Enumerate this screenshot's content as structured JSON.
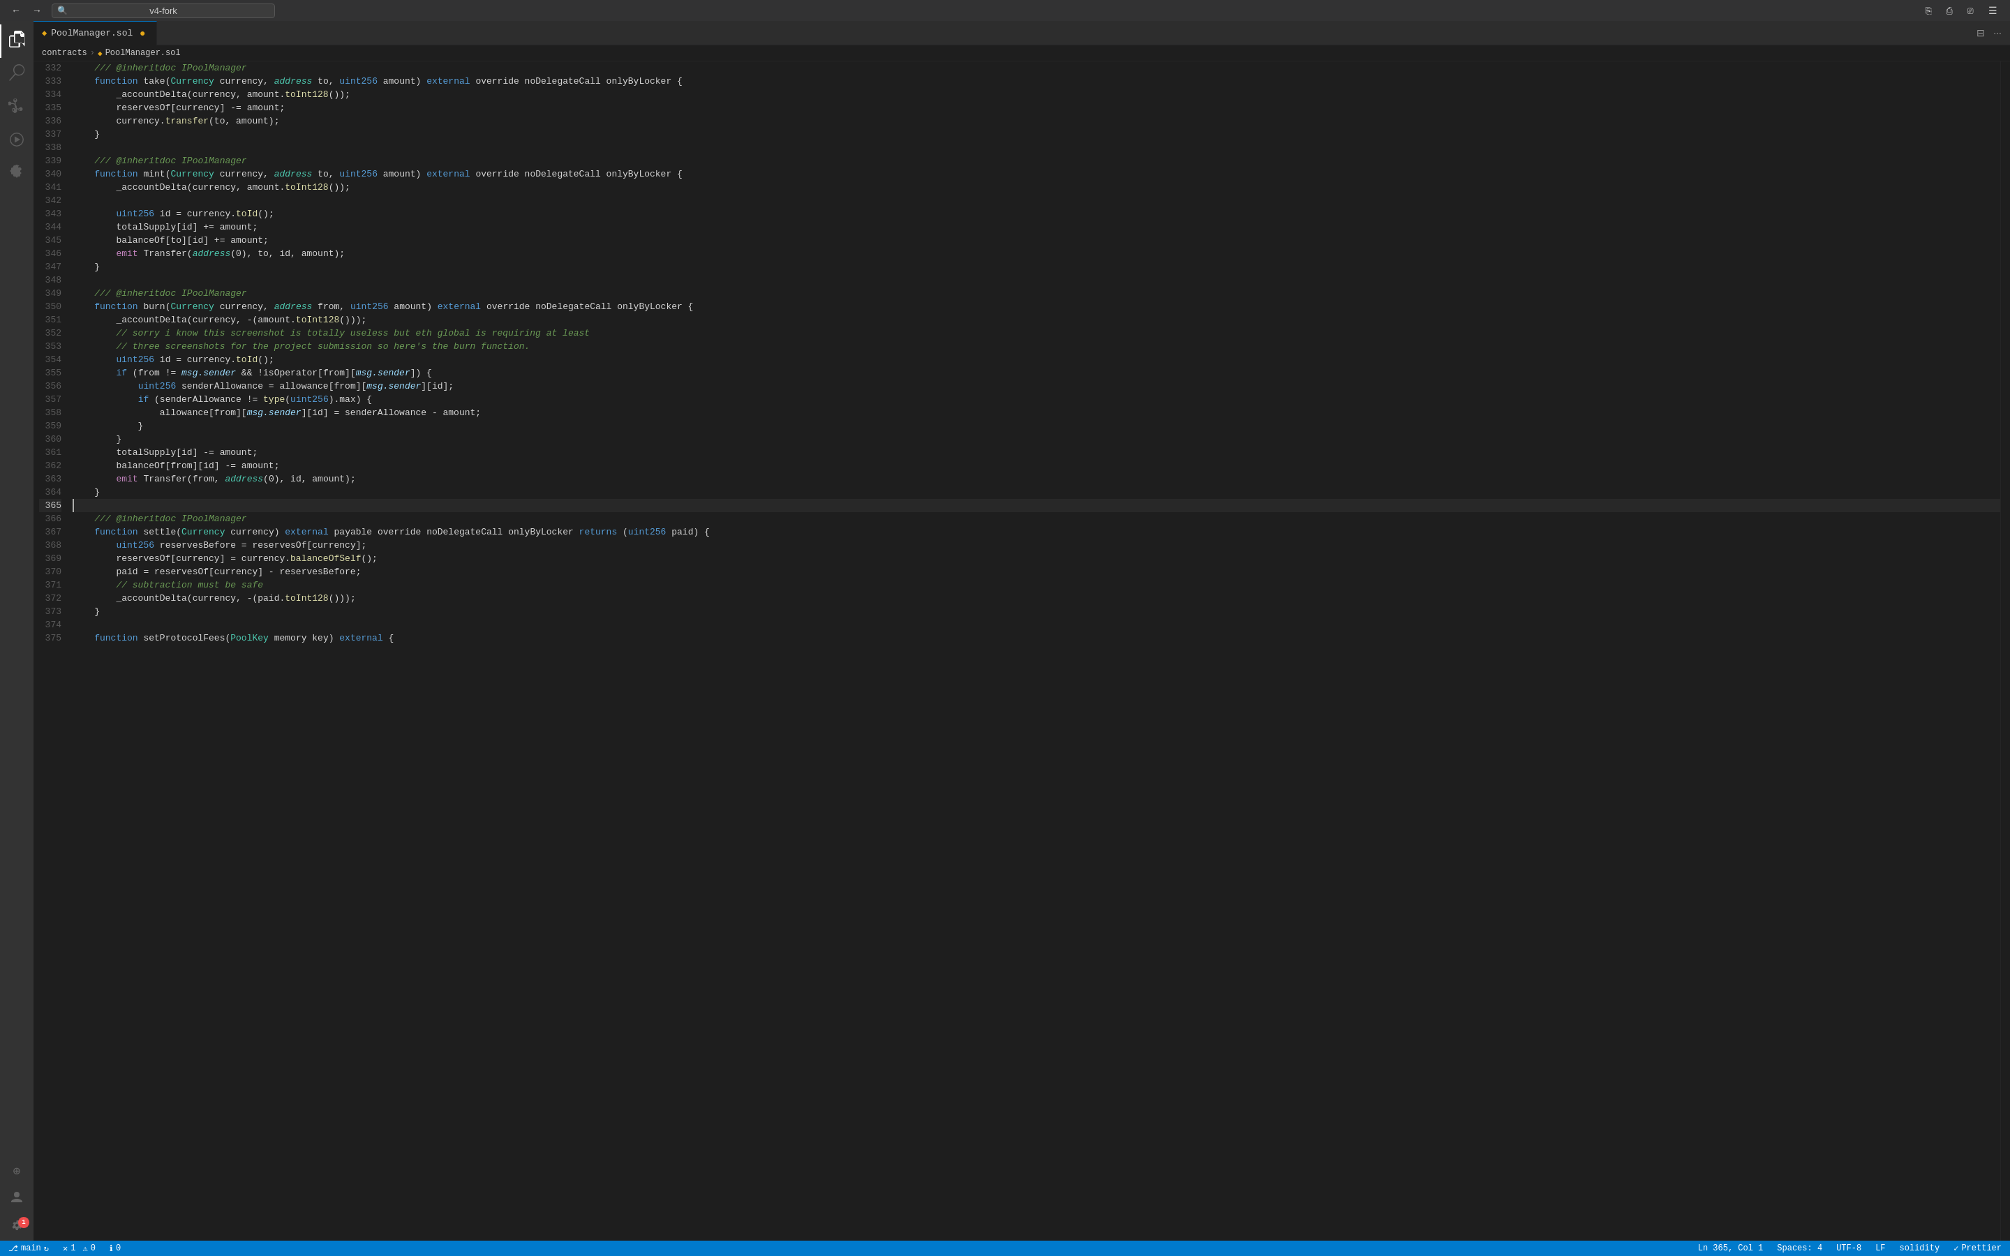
{
  "titlebar": {
    "search_placeholder": "v4-fork",
    "nav_back_disabled": false,
    "nav_forward_disabled": false
  },
  "tab": {
    "label": "PoolManager.sol",
    "modified_number": "1",
    "icon": "◆",
    "is_modified": true
  },
  "breadcrumb": {
    "part1": "contracts",
    "sep1": ">",
    "part2": "PoolManager.sol"
  },
  "status_bar": {
    "branch": "main",
    "sync_icon": "↻",
    "errors": "1",
    "warnings": "0",
    "info": "0",
    "position": "Ln 365, Col 1",
    "spaces": "Spaces: 4",
    "encoding": "UTF-8",
    "line_ending": "LF",
    "language": "solidity",
    "formatter": "Prettier"
  },
  "lines": [
    {
      "num": 332,
      "tokens": [
        {
          "t": "    /// @inheritdoc IPoolManager",
          "c": "comment"
        }
      ]
    },
    {
      "num": 333,
      "tokens": [
        {
          "t": "    ",
          "c": "plain"
        },
        {
          "t": "function",
          "c": "kw"
        },
        {
          "t": " take(",
          "c": "plain"
        },
        {
          "t": "Currency",
          "c": "type"
        },
        {
          "t": " currency, ",
          "c": "plain"
        },
        {
          "t": "address",
          "c": "addr"
        },
        {
          "t": " to, ",
          "c": "plain"
        },
        {
          "t": "uint256",
          "c": "kw"
        },
        {
          "t": " amount) ",
          "c": "plain"
        },
        {
          "t": "external",
          "c": "kw"
        },
        {
          "t": " override noDelegateCall onlyByLocker {",
          "c": "plain"
        }
      ]
    },
    {
      "num": 334,
      "tokens": [
        {
          "t": "        _accountDelta(currency, amount.",
          "c": "plain"
        },
        {
          "t": "toInt128",
          "c": "fn"
        },
        {
          "t": "());",
          "c": "plain"
        }
      ]
    },
    {
      "num": 335,
      "tokens": [
        {
          "t": "        reservesOf[currency] -= amount;",
          "c": "plain"
        }
      ]
    },
    {
      "num": 336,
      "tokens": [
        {
          "t": "        currency.",
          "c": "plain"
        },
        {
          "t": "transfer",
          "c": "fn"
        },
        {
          "t": "(to, amount);",
          "c": "plain"
        }
      ]
    },
    {
      "num": 337,
      "tokens": [
        {
          "t": "    }",
          "c": "plain"
        }
      ]
    },
    {
      "num": 338,
      "tokens": [
        {
          "t": "",
          "c": "plain"
        }
      ]
    },
    {
      "num": 339,
      "tokens": [
        {
          "t": "    /// @inheritdoc IPoolManager",
          "c": "comment"
        }
      ]
    },
    {
      "num": 340,
      "tokens": [
        {
          "t": "    ",
          "c": "plain"
        },
        {
          "t": "function",
          "c": "kw"
        },
        {
          "t": " mint(",
          "c": "plain"
        },
        {
          "t": "Currency",
          "c": "type"
        },
        {
          "t": " currency, ",
          "c": "plain"
        },
        {
          "t": "address",
          "c": "addr"
        },
        {
          "t": " to, ",
          "c": "plain"
        },
        {
          "t": "uint256",
          "c": "kw"
        },
        {
          "t": " amount) ",
          "c": "plain"
        },
        {
          "t": "external",
          "c": "kw"
        },
        {
          "t": " override noDelegateCall onlyByLocker {",
          "c": "plain"
        }
      ]
    },
    {
      "num": 341,
      "tokens": [
        {
          "t": "        _accountDelta(currency, amount.",
          "c": "plain"
        },
        {
          "t": "toInt128",
          "c": "fn"
        },
        {
          "t": "());",
          "c": "plain"
        }
      ]
    },
    {
      "num": 342,
      "tokens": [
        {
          "t": "",
          "c": "plain"
        }
      ]
    },
    {
      "num": 343,
      "tokens": [
        {
          "t": "        ",
          "c": "plain"
        },
        {
          "t": "uint256",
          "c": "kw"
        },
        {
          "t": " id = currency.",
          "c": "plain"
        },
        {
          "t": "toId",
          "c": "fn"
        },
        {
          "t": "();",
          "c": "plain"
        }
      ]
    },
    {
      "num": 344,
      "tokens": [
        {
          "t": "        totalSupply[id] += amount;",
          "c": "plain"
        }
      ]
    },
    {
      "num": 345,
      "tokens": [
        {
          "t": "        balanceOf[to][id] += amount;",
          "c": "plain"
        }
      ]
    },
    {
      "num": 346,
      "tokens": [
        {
          "t": "        ",
          "c": "plain"
        },
        {
          "t": "emit",
          "c": "kw2"
        },
        {
          "t": " Transfer(",
          "c": "plain"
        },
        {
          "t": "address",
          "c": "addr"
        },
        {
          "t": "(0), to, id, amount);",
          "c": "plain"
        }
      ]
    },
    {
      "num": 347,
      "tokens": [
        {
          "t": "    }",
          "c": "plain"
        }
      ]
    },
    {
      "num": 348,
      "tokens": [
        {
          "t": "",
          "c": "plain"
        }
      ]
    },
    {
      "num": 349,
      "tokens": [
        {
          "t": "    /// @inheritdoc IPoolManager",
          "c": "comment"
        }
      ]
    },
    {
      "num": 350,
      "tokens": [
        {
          "t": "    ",
          "c": "plain"
        },
        {
          "t": "function",
          "c": "kw"
        },
        {
          "t": " burn(",
          "c": "plain"
        },
        {
          "t": "Currency",
          "c": "type"
        },
        {
          "t": " currency, ",
          "c": "plain"
        },
        {
          "t": "address",
          "c": "addr"
        },
        {
          "t": " from, ",
          "c": "plain"
        },
        {
          "t": "uint256",
          "c": "kw"
        },
        {
          "t": " amount) ",
          "c": "plain"
        },
        {
          "t": "external",
          "c": "kw"
        },
        {
          "t": " override noDelegateCall onlyByLocker {",
          "c": "plain"
        }
      ]
    },
    {
      "num": 351,
      "tokens": [
        {
          "t": "        _accountDelta(currency, -(amount.",
          "c": "plain"
        },
        {
          "t": "toInt128",
          "c": "fn"
        },
        {
          "t": "()));",
          "c": "plain"
        }
      ]
    },
    {
      "num": 352,
      "tokens": [
        {
          "t": "        // sorry i know this screenshot is totally useless but eth global is requiring at least",
          "c": "comment"
        }
      ]
    },
    {
      "num": 353,
      "tokens": [
        {
          "t": "        // three screenshots for the project submission so here's the burn function.",
          "c": "comment"
        }
      ]
    },
    {
      "num": 354,
      "tokens": [
        {
          "t": "        ",
          "c": "plain"
        },
        {
          "t": "uint256",
          "c": "kw"
        },
        {
          "t": " id = currency.",
          "c": "plain"
        },
        {
          "t": "toId",
          "c": "fn"
        },
        {
          "t": "();",
          "c": "plain"
        }
      ]
    },
    {
      "num": 355,
      "tokens": [
        {
          "t": "        ",
          "c": "plain"
        },
        {
          "t": "if",
          "c": "kw"
        },
        {
          "t": " (from != ",
          "c": "plain"
        },
        {
          "t": "msg.sender",
          "c": "italic-param"
        },
        {
          "t": " && !isOperator[from][",
          "c": "plain"
        },
        {
          "t": "msg.sender",
          "c": "italic-param"
        },
        {
          "t": "]) {",
          "c": "plain"
        }
      ]
    },
    {
      "num": 356,
      "tokens": [
        {
          "t": "            ",
          "c": "plain"
        },
        {
          "t": "uint256",
          "c": "kw"
        },
        {
          "t": " senderAllowance = allowance[from][",
          "c": "plain"
        },
        {
          "t": "msg.sender",
          "c": "italic-param"
        },
        {
          "t": "][id];",
          "c": "plain"
        }
      ]
    },
    {
      "num": 357,
      "tokens": [
        {
          "t": "            ",
          "c": "plain"
        },
        {
          "t": "if",
          "c": "kw"
        },
        {
          "t": " (senderAllowance != ",
          "c": "plain"
        },
        {
          "t": "type",
          "c": "fn"
        },
        {
          "t": "(",
          "c": "plain"
        },
        {
          "t": "uint256",
          "c": "kw"
        },
        {
          "t": ").max) {",
          "c": "plain"
        }
      ]
    },
    {
      "num": 358,
      "tokens": [
        {
          "t": "                allowance[from][",
          "c": "plain"
        },
        {
          "t": "msg.sender",
          "c": "italic-param"
        },
        {
          "t": "][id] = senderAllowance - amount;",
          "c": "plain"
        }
      ]
    },
    {
      "num": 359,
      "tokens": [
        {
          "t": "            }",
          "c": "plain"
        }
      ]
    },
    {
      "num": 360,
      "tokens": [
        {
          "t": "        }",
          "c": "plain"
        }
      ]
    },
    {
      "num": 361,
      "tokens": [
        {
          "t": "        totalSupply[id] -= amount;",
          "c": "plain"
        }
      ]
    },
    {
      "num": 362,
      "tokens": [
        {
          "t": "        balanceOf[from][id] -= amount;",
          "c": "plain"
        }
      ]
    },
    {
      "num": 363,
      "tokens": [
        {
          "t": "        ",
          "c": "plain"
        },
        {
          "t": "emit",
          "c": "kw2"
        },
        {
          "t": " Transfer(from, ",
          "c": "plain"
        },
        {
          "t": "address",
          "c": "addr"
        },
        {
          "t": "(0), id, amount);",
          "c": "plain"
        }
      ]
    },
    {
      "num": 364,
      "tokens": [
        {
          "t": "    }",
          "c": "plain"
        }
      ]
    },
    {
      "num": 365,
      "tokens": [
        {
          "t": "",
          "c": "plain"
        }
      ],
      "is_cursor": true
    },
    {
      "num": 366,
      "tokens": [
        {
          "t": "    /// @inheritdoc IPoolManager",
          "c": "comment"
        }
      ]
    },
    {
      "num": 367,
      "tokens": [
        {
          "t": "    ",
          "c": "plain"
        },
        {
          "t": "function",
          "c": "kw"
        },
        {
          "t": " settle(",
          "c": "plain"
        },
        {
          "t": "Currency",
          "c": "type"
        },
        {
          "t": " currency) ",
          "c": "plain"
        },
        {
          "t": "external",
          "c": "kw"
        },
        {
          "t": " payable override noDelegateCall onlyByLocker ",
          "c": "plain"
        },
        {
          "t": "returns",
          "c": "kw"
        },
        {
          "t": " (",
          "c": "plain"
        },
        {
          "t": "uint256",
          "c": "kw"
        },
        {
          "t": " paid) {",
          "c": "plain"
        }
      ]
    },
    {
      "num": 368,
      "tokens": [
        {
          "t": "        ",
          "c": "plain"
        },
        {
          "t": "uint256",
          "c": "kw"
        },
        {
          "t": " reservesBefore = reservesOf[currency];",
          "c": "plain"
        }
      ]
    },
    {
      "num": 369,
      "tokens": [
        {
          "t": "        reservesOf[currency] = currency.",
          "c": "plain"
        },
        {
          "t": "balanceOfSelf",
          "c": "fn"
        },
        {
          "t": "();",
          "c": "plain"
        }
      ]
    },
    {
      "num": 370,
      "tokens": [
        {
          "t": "        paid = reservesOf[currency] - reservesBefore;",
          "c": "plain"
        }
      ]
    },
    {
      "num": 371,
      "tokens": [
        {
          "t": "        // subtraction must be safe",
          "c": "comment"
        }
      ]
    },
    {
      "num": 372,
      "tokens": [
        {
          "t": "        _accountDelta(currency, -(paid.",
          "c": "plain"
        },
        {
          "t": "toInt128",
          "c": "fn"
        },
        {
          "t": "()));",
          "c": "plain"
        }
      ]
    },
    {
      "num": 373,
      "tokens": [
        {
          "t": "    }",
          "c": "plain"
        }
      ]
    },
    {
      "num": 374,
      "tokens": [
        {
          "t": "",
          "c": "plain"
        }
      ]
    },
    {
      "num": 375,
      "tokens": [
        {
          "t": "    ",
          "c": "plain"
        },
        {
          "t": "function",
          "c": "kw"
        },
        {
          "t": " setProtocolFees(",
          "c": "plain"
        },
        {
          "t": "PoolKey",
          "c": "type"
        },
        {
          "t": " memory key) ",
          "c": "plain"
        },
        {
          "t": "external",
          "c": "kw"
        },
        {
          "t": " {",
          "c": "plain"
        }
      ]
    }
  ],
  "activity_bar": {
    "items": [
      {
        "name": "explorer",
        "icon": "⎘",
        "active": true,
        "badge": null
      },
      {
        "name": "search",
        "icon": "🔍",
        "active": false,
        "badge": null
      },
      {
        "name": "source-control",
        "icon": "⎇",
        "active": false,
        "badge": null
      },
      {
        "name": "run-debug",
        "icon": "▷",
        "active": false,
        "badge": null
      },
      {
        "name": "extensions",
        "icon": "⊞",
        "active": false,
        "badge": null
      }
    ],
    "bottom_items": [
      {
        "name": "remote",
        "icon": "⊕",
        "badge": null
      },
      {
        "name": "account",
        "icon": "○",
        "badge": null
      },
      {
        "name": "settings",
        "icon": "⚙",
        "badge": "1"
      }
    ]
  }
}
